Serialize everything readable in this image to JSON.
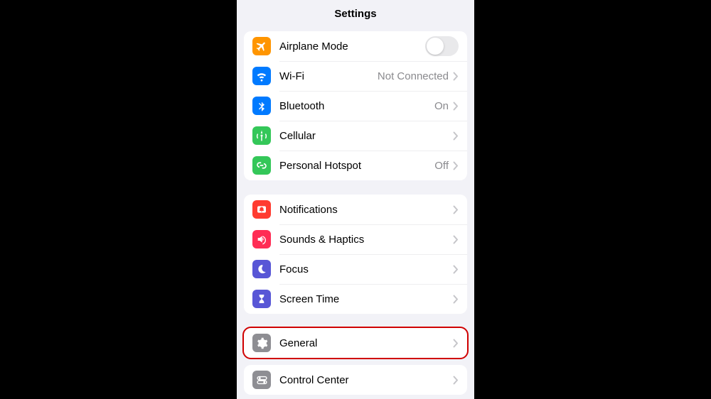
{
  "title": "Settings",
  "groups": [
    {
      "id": "connectivity",
      "items": [
        {
          "name": "airplane-mode",
          "label": "Airplane Mode",
          "icon": "airplane",
          "icon_bg": "#ff9500",
          "control": "toggle",
          "toggle_on": false
        },
        {
          "name": "wifi",
          "label": "Wi-Fi",
          "icon": "wifi",
          "icon_bg": "#007aff",
          "value": "Not Connected",
          "control": "chevron"
        },
        {
          "name": "bluetooth",
          "label": "Bluetooth",
          "icon": "bluetooth",
          "icon_bg": "#007aff",
          "value": "On",
          "control": "chevron"
        },
        {
          "name": "cellular",
          "label": "Cellular",
          "icon": "antenna",
          "icon_bg": "#34c759",
          "control": "chevron"
        },
        {
          "name": "personal-hotspot",
          "label": "Personal Hotspot",
          "icon": "hotspot",
          "icon_bg": "#34c759",
          "value": "Off",
          "control": "chevron"
        }
      ]
    },
    {
      "id": "preferences",
      "items": [
        {
          "name": "notifications",
          "label": "Notifications",
          "icon": "bell",
          "icon_bg": "#ff3b30",
          "control": "chevron"
        },
        {
          "name": "sounds-haptics",
          "label": "Sounds & Haptics",
          "icon": "speaker",
          "icon_bg": "#ff2d55",
          "control": "chevron"
        },
        {
          "name": "focus",
          "label": "Focus",
          "icon": "moon",
          "icon_bg": "#5856d6",
          "control": "chevron"
        },
        {
          "name": "screen-time",
          "label": "Screen Time",
          "icon": "hourglass",
          "icon_bg": "#5856d6",
          "control": "chevron"
        }
      ]
    },
    {
      "id": "general-group",
      "highlighted": true,
      "items": [
        {
          "name": "general",
          "label": "General",
          "icon": "gear",
          "icon_bg": "#8e8e93",
          "control": "chevron"
        }
      ]
    },
    {
      "id": "control-center-group",
      "items": [
        {
          "name": "control-center",
          "label": "Control Center",
          "icon": "switches",
          "icon_bg": "#8e8e93",
          "control": "chevron"
        }
      ]
    }
  ]
}
